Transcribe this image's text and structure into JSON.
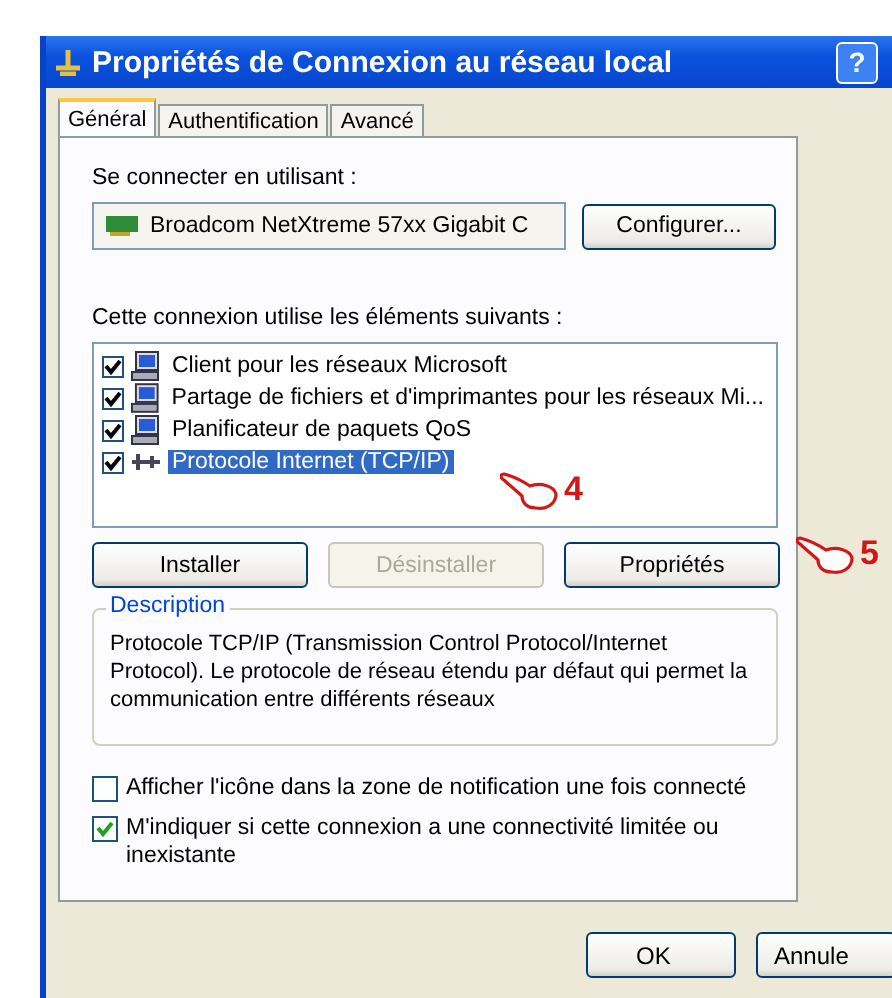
{
  "window": {
    "title": "Propriétés de Connexion au réseau local",
    "help": "?"
  },
  "tabs": [
    {
      "label": "Général",
      "selected": true
    },
    {
      "label": "Authentification",
      "selected": false
    },
    {
      "label": "Avancé",
      "selected": false
    }
  ],
  "connect_using": {
    "label": "Se connecter en utilisant :",
    "adapter": "Broadcom NetXtreme 57xx Gigabit C",
    "button": "Configurer..."
  },
  "components": {
    "label": "Cette connexion utilise les éléments suivants :",
    "items": [
      {
        "label": "Client pour les réseaux Microsoft",
        "checked": true,
        "selected": false,
        "kind": "computer"
      },
      {
        "label": "Partage de fichiers et d'imprimantes pour les réseaux Mi...",
        "checked": true,
        "selected": false,
        "kind": "computer"
      },
      {
        "label": "Planificateur de paquets QoS",
        "checked": true,
        "selected": false,
        "kind": "computer"
      },
      {
        "label": "Protocole Internet (TCP/IP)",
        "checked": true,
        "selected": true,
        "kind": "network"
      }
    ]
  },
  "actions": [
    {
      "label": "Installer",
      "disabled": false
    },
    {
      "label": "Désinstaller",
      "disabled": true
    },
    {
      "label": "Propriétés",
      "disabled": false
    }
  ],
  "description": {
    "title": "Description",
    "text": "Protocole TCP/IP (Transmission Control Protocol/Internet Protocol). Le protocole de réseau étendu par défaut qui permet la communication entre différents réseaux"
  },
  "options": [
    {
      "label": "Afficher l'icône dans la zone de notification une fois connecté",
      "checked": false
    },
    {
      "label": "M'indiquer si cette connexion a une connectivité limitée ou inexistante",
      "checked": true
    }
  ],
  "buttons": [
    "OK",
    "Annule"
  ],
  "callouts": [
    {
      "number": "4"
    },
    {
      "number": "5"
    }
  ]
}
